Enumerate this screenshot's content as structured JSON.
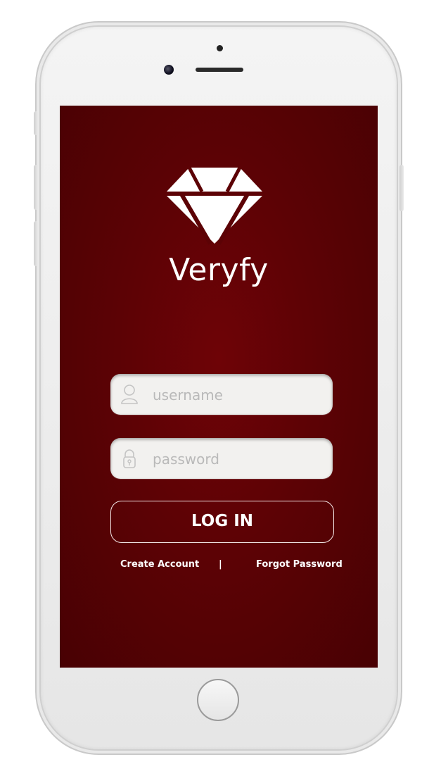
{
  "app": {
    "name": "Veryfy",
    "logo_icon": "diamond-icon"
  },
  "form": {
    "username": {
      "placeholder": "username",
      "value": "",
      "icon": "user-icon"
    },
    "password": {
      "placeholder": "password",
      "value": "",
      "icon": "lock-icon"
    },
    "login_label": "LOG IN"
  },
  "links": {
    "create_account": "Create Account",
    "separator": "|",
    "forgot_password": "Forgot Password"
  },
  "colors": {
    "background_center": "#6e0306",
    "background_edge": "#480103",
    "field_background": "#f2f1ef",
    "text": "#ffffff"
  }
}
